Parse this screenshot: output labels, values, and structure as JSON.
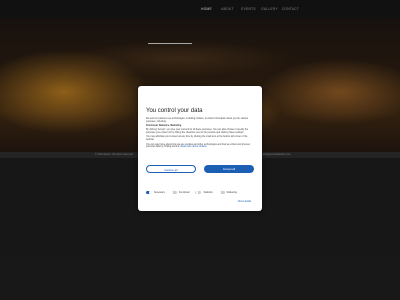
{
  "nav": {
    "items": [
      {
        "label": "HOME",
        "active": true
      },
      {
        "label": "ABOUT",
        "active": false
      },
      {
        "label": "EVENTS",
        "active": false
      },
      {
        "label": "GALLERY",
        "active": false
      },
      {
        "label": "CONTACT",
        "active": false
      }
    ]
  },
  "hero": {
    "scroll_icon": "▲"
  },
  "footer": {
    "left_text": "© 2024 Event. All rights reserved",
    "right_text": "info@eventwebsite.com"
  },
  "consent": {
    "title": "You control your data",
    "paragraphs": [
      "We and our partners use technologies, including cookies, to collect information about you for various purposes, including:",
      "By clicking 'Accept', you give your consent for all these purposes. You can also choose to specify the purposes you consent to by ticking the checkbox next to the purpose and clicking 'Save settings'.",
      "You may withdraw your consent at any time by clicking the small icon at the bottom left corner of the website.",
      "You can read more about how we use cookies and other technologies and how we collect and process personal data by clicking the link."
    ],
    "purposes": "Functional, Statistics, Marketing",
    "read_more": "Read more about cookies",
    "decline_label": "Decline all",
    "accept_label": "Accept all",
    "options": [
      {
        "label": "Necessary",
        "on": true
      },
      {
        "label": "Functional",
        "on": false
      },
      {
        "label": "Statistics",
        "on": false
      },
      {
        "label": "Marketing",
        "on": false
      }
    ],
    "show_details": "Show details"
  },
  "colors": {
    "accent": "#1a5fb4",
    "background": "#1b1b1b"
  }
}
